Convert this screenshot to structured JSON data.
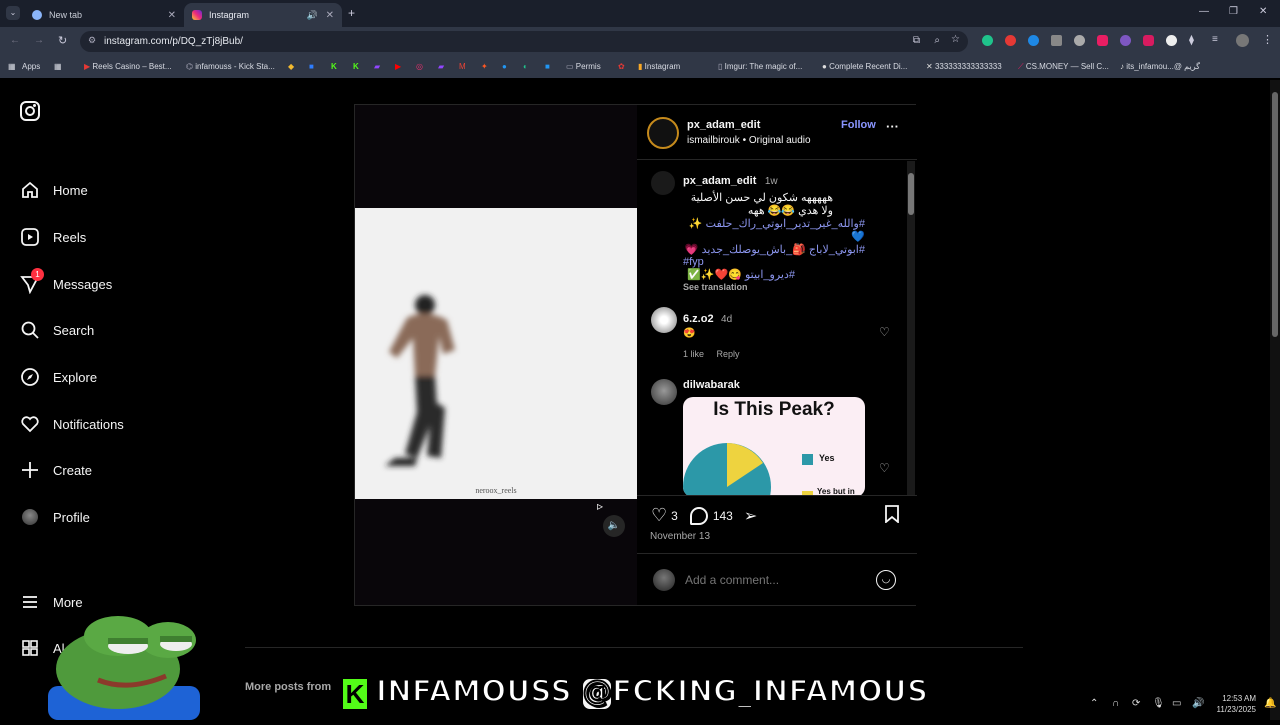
{
  "tabs": [
    {
      "label": "New tab",
      "active": false
    },
    {
      "label": "Instagram",
      "active": true
    }
  ],
  "address_bar": {
    "url": "instagram.com/p/DQ_zTj8jBub/"
  },
  "bookmarks": [
    "Apps",
    "Reels Casino – Best...",
    "infamouss - Kick Sta...",
    "Permis",
    "Instagram",
    "Imgur: The magic of...",
    "Complete Recent Di...",
    "333333333333333",
    "CS.MONEY — Sell C...",
    "its_infamou...@ گريم"
  ],
  "sidebar": {
    "items": [
      {
        "label": "Home",
        "icon": "home-icon"
      },
      {
        "label": "Reels",
        "icon": "reels-icon"
      },
      {
        "label": "Messages",
        "icon": "messages-icon",
        "badge": "1"
      },
      {
        "label": "Search",
        "icon": "search-icon"
      },
      {
        "label": "Explore",
        "icon": "explore-icon"
      },
      {
        "label": "Notifications",
        "icon": "heart-icon"
      },
      {
        "label": "Create",
        "icon": "plus-icon"
      },
      {
        "label": "Profile",
        "icon": "avatar"
      }
    ],
    "more_label": "More",
    "also_label": "Al"
  },
  "post": {
    "author": "px_adam_edit",
    "follow_label": "Follow",
    "audio_author": "ismailbirouk",
    "audio_label": "Original audio",
    "video_watermark": "neroox_reels",
    "caption": {
      "username": "px_adam_edit",
      "time": "1w",
      "text": "هههههه شكون لي حسن الأصلية ولا هدي 😂😂 ههه",
      "tag_line_1": "#والله_غير_تدير_ابوتي_راك_حلفت ✨💙",
      "tag_line_2": "#ابوتي_لاباج 🎒_باش_يوصلك_جديد 💗",
      "tag_line_3": "#fyp",
      "tag_line_4": "#ديرو_ابيتو 😋❤️✨✅",
      "see_translation": "See translation"
    },
    "comments": [
      {
        "username": "6.z.o2",
        "time": "4d",
        "text": "😍",
        "likes": "1 like",
        "reply": "Reply"
      },
      {
        "username": "dilwabarak",
        "image_title": "Is This Peak?",
        "legend_yes": "Yes",
        "legend_yes_but": "Yes but in"
      }
    ],
    "like_count": "3",
    "comment_count": "143",
    "date": "November 13",
    "comment_placeholder": "Add a comment..."
  },
  "more_posts_label": "More posts from",
  "overlay_banner": "INFAMOUSS @FCKING_INFAMOUS",
  "taskbar": {
    "time": "12:53 AM",
    "date": "11/23/2025"
  },
  "colors": {
    "follow": "#8a96ff",
    "badge": "#ff3040",
    "kick": "#53fc18",
    "hashtag": "#8d97f0"
  }
}
